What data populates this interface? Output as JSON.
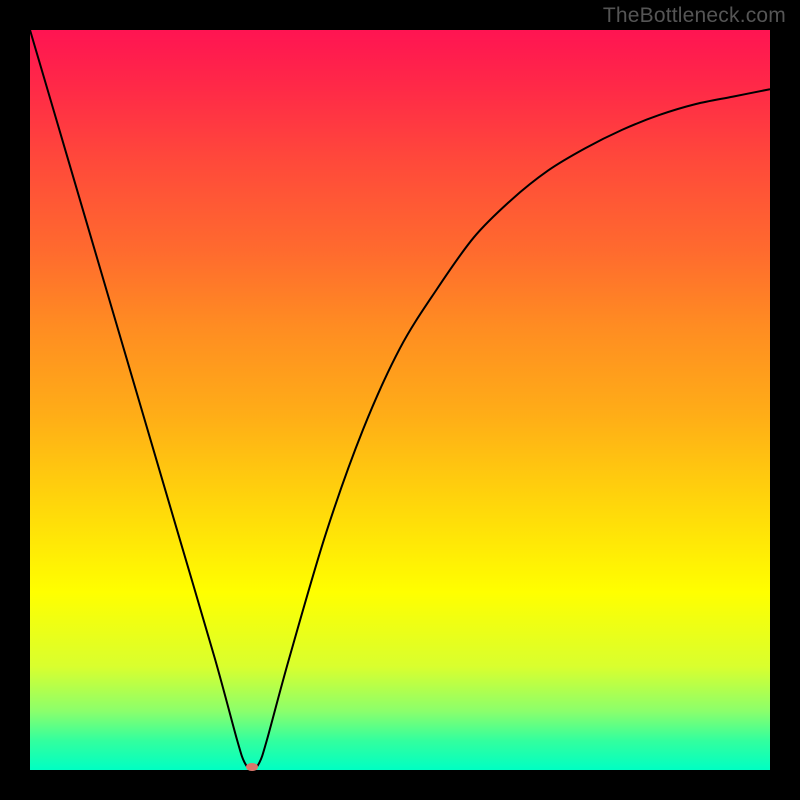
{
  "watermark": "TheBottleneck.com",
  "chart_data": {
    "type": "line",
    "title": "",
    "xlabel": "",
    "ylabel": "",
    "xlim": [
      0,
      100
    ],
    "ylim": [
      0,
      100
    ],
    "series": [
      {
        "name": "bottleneck-curve",
        "x": [
          0,
          5,
          10,
          15,
          20,
          25,
          28,
          29,
          30,
          31,
          32,
          35,
          40,
          45,
          50,
          55,
          60,
          65,
          70,
          75,
          80,
          85,
          90,
          95,
          100
        ],
        "y": [
          100,
          83,
          66,
          49,
          32,
          15,
          4,
          1,
          0,
          1,
          4,
          15,
          32,
          46,
          57,
          65,
          72,
          77,
          81,
          84,
          86.5,
          88.5,
          90,
          91,
          92
        ]
      }
    ],
    "minimum_point": {
      "x": 30,
      "y": 0
    },
    "minimum_marker_color": "#d9776b",
    "curve_color": "#000000"
  }
}
